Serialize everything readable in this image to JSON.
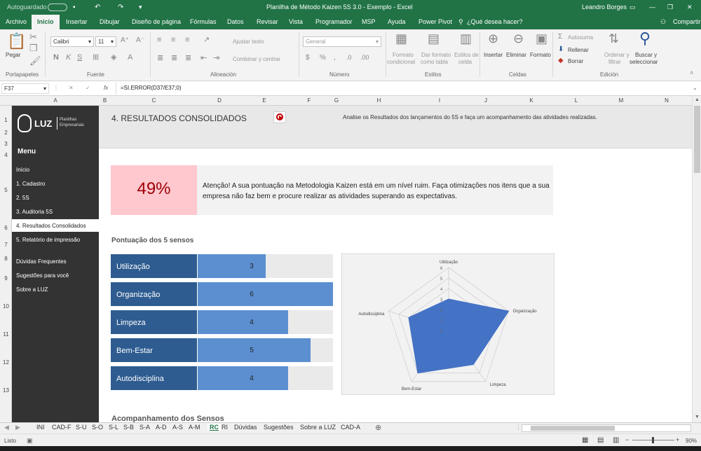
{
  "titlebar": {
    "autosave": "Autoguardado",
    "autosave_state": "Desactivado",
    "doc_title": "Planilha de Método Kaizen 5S 3.0 - Exemplo  -  Excel",
    "user": "Leandro Borges"
  },
  "menu": [
    "Archivo",
    "Inicio",
    "Insertar",
    "Dibujar",
    "Diseño de página",
    "Fórmulas",
    "Datos",
    "Revisar",
    "Vista",
    "Programador",
    "MSP",
    "Ayuda",
    "Power Pivot"
  ],
  "menu_active": "Inicio",
  "tellme": "¿Qué desea hacer?",
  "share": "Compartir",
  "ribbon": {
    "paste": "Pegar",
    "clipboard": "Portapapeles",
    "font_name": "Calibri",
    "font_size": "11",
    "font": "Fuente",
    "wrap": "Ajustar texto",
    "merge": "Combinar y centrar",
    "alignment": "Alineación",
    "number_format": "General",
    "number": "Número",
    "cond_format_1": "Formato",
    "cond_format_2": "condicional",
    "table_format_1": "Dar formato",
    "table_format_2": "como tabla",
    "cell_styles_1": "Estilos de",
    "cell_styles_2": "celda",
    "styles": "Estilos",
    "insert": "Insertar",
    "delete": "Eliminar",
    "format": "Formato",
    "cells": "Celdas",
    "autosum": "Autosuma",
    "fill": "Rellenar",
    "clear": "Borrar",
    "sort_1": "Ordenar y",
    "sort_2": "filtrar",
    "find_1": "Buscar y",
    "find_2": "seleccionar",
    "editing": "Edición"
  },
  "formula_bar": {
    "cell_ref": "F37",
    "fx": "fx",
    "formula": "=SI.ERROR(D37/E37;0)"
  },
  "columns": [
    "A",
    "B",
    "C",
    "D",
    "E",
    "F",
    "G",
    "H",
    "I",
    "J",
    "K",
    "L",
    "M",
    "N"
  ],
  "rows": [
    "1",
    "2",
    "3",
    "4",
    "5",
    "6",
    "7",
    "8",
    "9",
    "10",
    "11",
    "12",
    "13"
  ],
  "sidebar": {
    "logo_text": "LUZ",
    "logo_sub_1": "Planilhas",
    "logo_sub_2": "Empresariais",
    "menu_title": "Menu",
    "items": [
      "Início",
      "1. Cadastro",
      "2. 5S",
      "3. Auditoria 5S",
      "4. Resultados Consolidados",
      "5. Relatório de impressão"
    ],
    "active_index": 4,
    "extra": [
      "Dúvidas Frequentes",
      "Sugestões para você",
      "Sobre a LUZ"
    ]
  },
  "page": {
    "title": "4. RESULTADOS CONSOLIDADOS",
    "subtitle": "Analise os Resultados dos lançamentos do 5S e faça um acompanhamento das atividades realizadas.",
    "score": "49%",
    "alert": "Atenção! A sua pontuação na Metodologia Kaizen está em um nível ruim. Faça otimizações nos itens que a sua empresa não faz bem e procure realizar as atividades superando as expectativas.",
    "section_title": "Pontuação dos 5 sensos",
    "next_section": "Acompanhamento dos Sensos",
    "accent_red": "#c00000",
    "score_bg": "#ffc7ce",
    "bar_label_bg": "#2e5c90",
    "bar_value_bg": "#5b8fd0"
  },
  "chart_data": {
    "type": "bar",
    "orientation": "horizontal",
    "categories": [
      "Utilização",
      "Organização",
      "Limpeza",
      "Bem-Estar",
      "Autodisciplina"
    ],
    "values": [
      3,
      6,
      4,
      5,
      4
    ],
    "xlim": [
      0,
      6
    ]
  },
  "radar_data": {
    "type": "radar",
    "categories": [
      "Utilização",
      "Organização",
      "Limpeza",
      "Bem-Estar",
      "Autodisciplina"
    ],
    "values": [
      3,
      6,
      4,
      5,
      4
    ],
    "ticks": [
      "0",
      "1",
      "2",
      "3",
      "4",
      "5",
      "6"
    ],
    "range": [
      0,
      6
    ]
  },
  "sheets": [
    "INI",
    "CAD-F",
    "S-U",
    "S-O",
    "S-L",
    "S-B",
    "S-A",
    "A-D",
    "A-S",
    "A-M",
    "RC",
    "RI",
    "Dúvidas",
    "Sugestões",
    "Sobre a LUZ",
    "CAD-A"
  ],
  "active_sheet": "RC",
  "status": {
    "ready": "Listo",
    "zoom": "90%"
  }
}
